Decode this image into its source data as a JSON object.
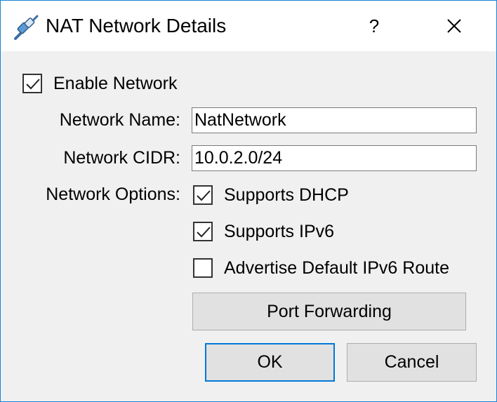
{
  "window": {
    "title": "NAT Network Details",
    "help_label": "?",
    "close_label": "✕"
  },
  "form": {
    "enable_network": {
      "label": "Enable Network",
      "checked": true
    },
    "network_name": {
      "label": "Network Name:",
      "value": "NatNetwork"
    },
    "network_cidr": {
      "label": "Network CIDR:",
      "value": "10.0.2.0/24"
    },
    "network_options": {
      "label": "Network Options:",
      "supports_dhcp": {
        "label": "Supports DHCP",
        "checked": true
      },
      "supports_ipv6": {
        "label": "Supports IPv6",
        "checked": true
      },
      "advertise_ipv6_route": {
        "label": "Advertise Default IPv6 Route",
        "checked": false
      }
    },
    "port_forwarding_label": "Port Forwarding"
  },
  "buttons": {
    "ok_label": "OK",
    "cancel_label": "Cancel"
  },
  "colors": {
    "window_border": "#1883d7",
    "dialog_background": "#f0f0f0",
    "default_button_border": "#0078d7"
  }
}
